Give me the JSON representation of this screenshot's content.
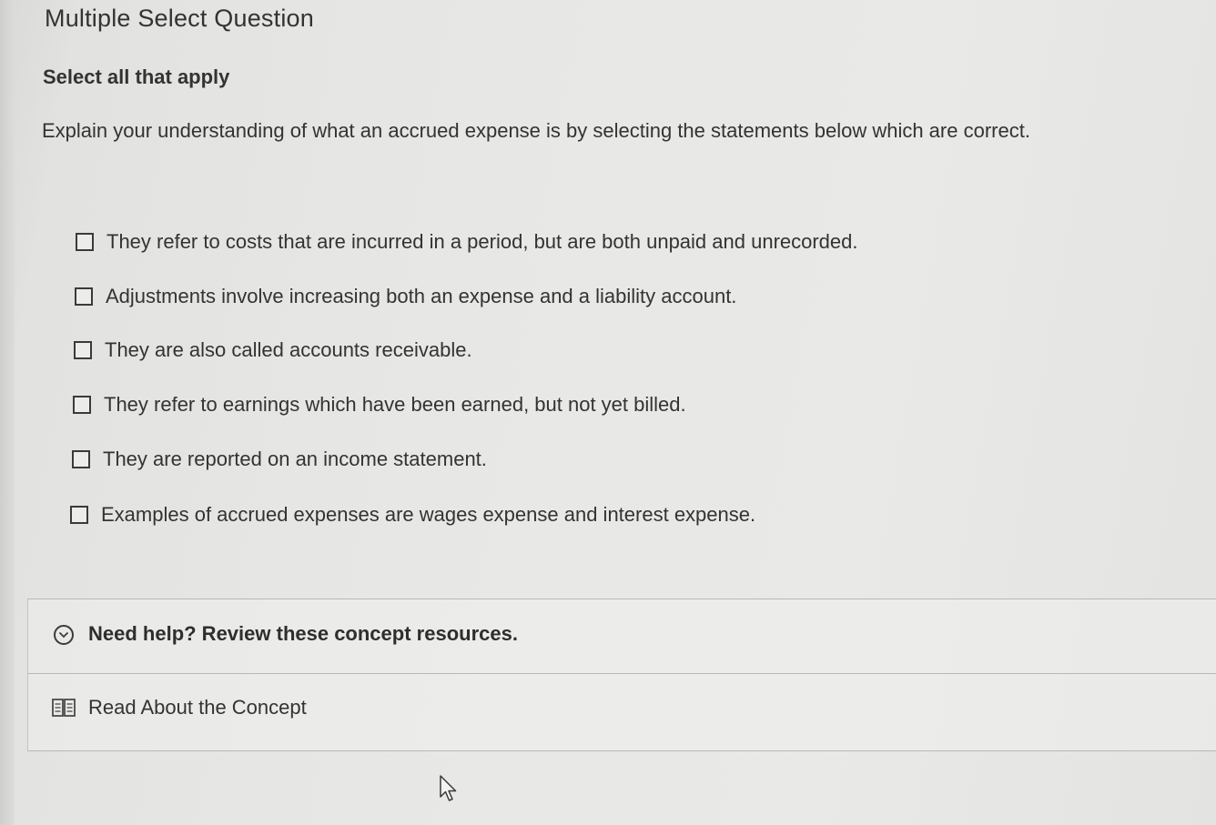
{
  "question": {
    "type_label": "Multiple Select Question",
    "instruction": "Select all that apply",
    "prompt": "Explain your understanding of what an accrued expense is by selecting the statements below which are correct."
  },
  "options": [
    {
      "label": "They refer to costs that are incurred in a period, but are both unpaid and unrecorded.",
      "checked": false
    },
    {
      "label": "Adjustments involve increasing both an expense and a liability account.",
      "checked": false
    },
    {
      "label": "They are also called accounts receivable.",
      "checked": false
    },
    {
      "label": "They refer to earnings which have been earned, but not yet billed.",
      "checked": false
    },
    {
      "label": "They are reported on an income statement.",
      "checked": false
    },
    {
      "label": "Examples of accrued expenses are wages expense and interest expense.",
      "checked": false
    }
  ],
  "help": {
    "title": "Need help? Review these concept resources.",
    "toggle_icon": "chevron-down-circle-icon",
    "resources": [
      {
        "label": "Read About the Concept",
        "icon": "book-icon"
      }
    ]
  },
  "cursor_icon": "mouse-pointer-icon"
}
